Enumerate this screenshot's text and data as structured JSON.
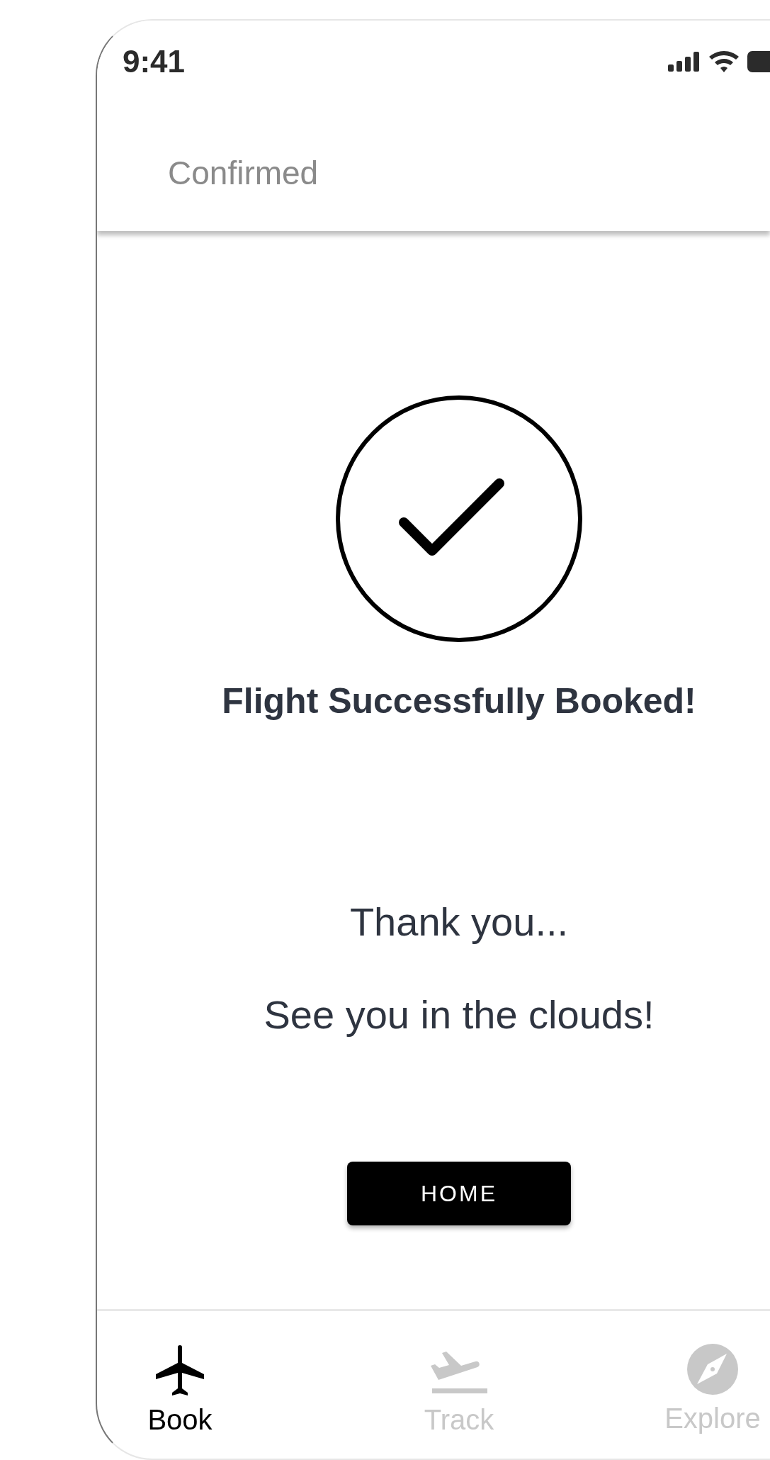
{
  "status_bar": {
    "time": "9:41"
  },
  "header": {
    "title": "Confirmed"
  },
  "confirmation": {
    "title": "Flight Successfully Booked!",
    "messages": [
      "Thank you...",
      "See you in the clouds!"
    ],
    "button": "HOME"
  },
  "tab_bar": [
    {
      "kind": "plane",
      "label": "Book",
      "selected": true
    },
    {
      "kind": "takeoff",
      "label": "Track",
      "selected": false
    },
    {
      "kind": "compass",
      "label": "Explore",
      "selected": false
    }
  ]
}
